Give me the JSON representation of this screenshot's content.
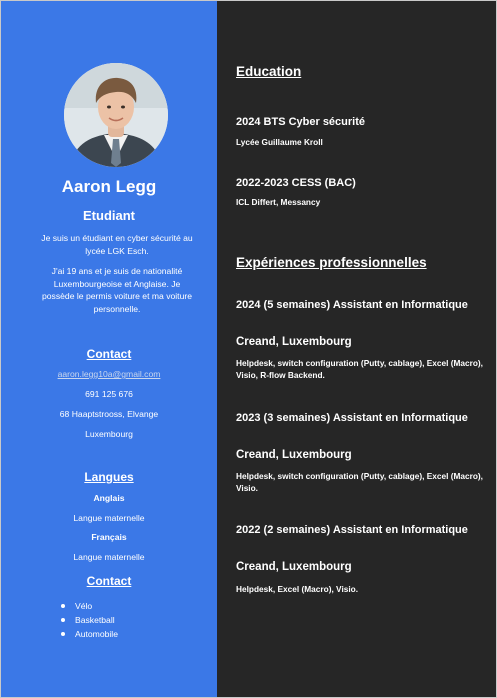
{
  "sidebar": {
    "name": "Aaron Legg",
    "role": "Etudiant",
    "bio1": "Je suis un étudiant en cyber sécurité au lycée LGK Esch.",
    "bio2": "J'ai 19 ans et je suis de nationalité Luxembourgeoise et Anglaise. Je possède le permis voiture et ma voiture personnelle.",
    "contact_heading": "Contact",
    "email": "aaron.legg10a@gmail.com",
    "phone": "691 125 676",
    "address": "68 Haaptstrooss, Elvange",
    "country": "Luxembourg",
    "languages_heading": "Langues",
    "languages": [
      {
        "name": "Anglais",
        "level": "Langue maternelle"
      },
      {
        "name": "Français",
        "level": "Langue maternelle"
      }
    ],
    "hobbies_heading": "Contact",
    "hobbies": [
      "Vélo",
      "Basketball",
      "Automobile"
    ]
  },
  "main": {
    "education_heading": "Education",
    "education": [
      {
        "title": "2024 BTS Cyber sécurité",
        "school": "Lycée Guillaume Kroll"
      },
      {
        "title": "2022-2023 CESS (BAC)",
        "school": "ICL Differt, Messancy"
      }
    ],
    "experience_heading": "Expériences professionnelles",
    "experiences": [
      {
        "title": "2024 (5 semaines) Assistant en Informatique",
        "company": "Creand, Luxembourg",
        "details": "Helpdesk, switch configuration (Putty, cablage), Excel (Macro), Visio, R-flow Backend."
      },
      {
        "title": "2023 (3 semaines) Assistant en Informatique",
        "company": "Creand, Luxembourg",
        "details": "Helpdesk, switch configuration (Putty, cablage), Excel (Macro), Visio."
      },
      {
        "title": "2022 (2 semaines) Assistant en Informatique",
        "company": "Creand, Luxembourg",
        "details": "Helpdesk, Excel (Macro), Visio."
      }
    ]
  }
}
